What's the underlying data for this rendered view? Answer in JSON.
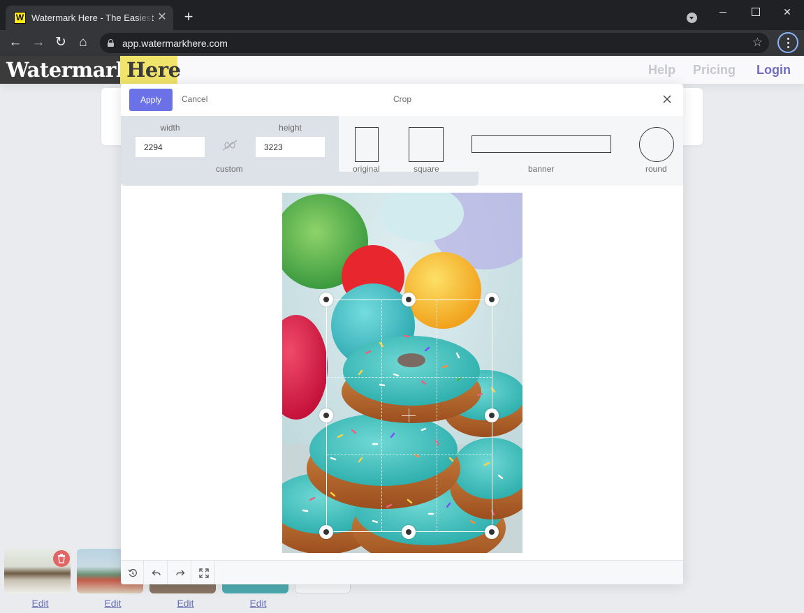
{
  "browser": {
    "tab_title": "Watermark Here - The Easiest Online Watermarking Tool",
    "tab_favicon": "W",
    "url": "app.watermarkhere.com"
  },
  "site": {
    "logo_part1": "Watermark",
    "logo_part2": "Here",
    "nav": {
      "help": "Help",
      "pricing": "Pricing",
      "login": "Login"
    },
    "colors": {
      "logo_dark": "#3b3b3b",
      "logo_yellow": "#f0e46a",
      "login": "#6f6cc2",
      "apply": "#6b72e8"
    }
  },
  "crop_modal": {
    "apply_label": "Apply",
    "cancel_label": "Cancel",
    "title": "Crop",
    "width_label": "width",
    "height_label": "height",
    "width_value": "2294",
    "height_value": "3223",
    "custom_label": "custom",
    "presets": {
      "original": "original",
      "square": "square",
      "banner": "banner",
      "round": "round"
    }
  },
  "thumbnails": {
    "edit_labels": [
      "Edit",
      "Edit",
      "Edit",
      "Edit"
    ]
  }
}
